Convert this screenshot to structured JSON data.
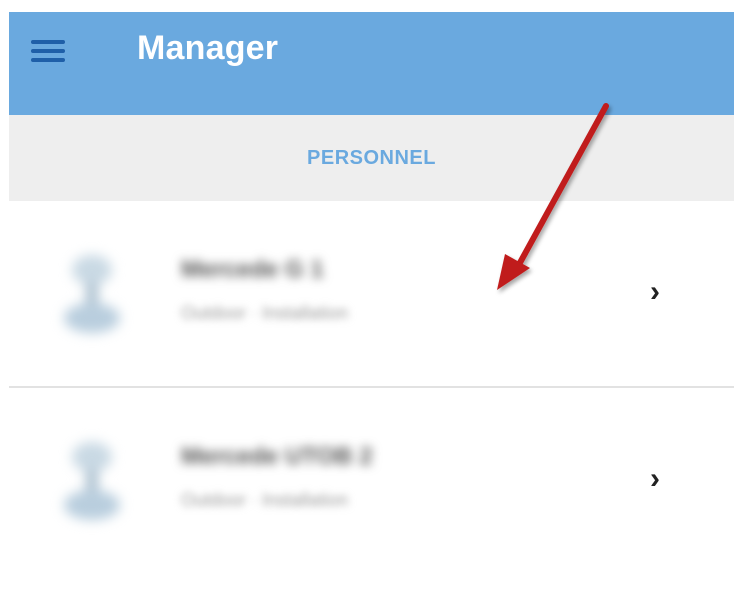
{
  "colors": {
    "appbar_bg": "#6aa9df",
    "menu_icon": "#1f5fa8",
    "tab_text": "#6aa9df",
    "annotation_arrow": "#c01a1a"
  },
  "appbar": {
    "title": "Manager",
    "menu_icon": "hamburger-menu-icon"
  },
  "tabs": [
    {
      "label": "PERSONNEL",
      "active": true
    }
  ],
  "list": {
    "items": [
      {
        "title": "Mercede G 1",
        "subtitle": "Outdoor · Installation",
        "avatar_icon": "device-avatar-icon",
        "chevron": "›"
      },
      {
        "title": "Mercede UTOB 2",
        "subtitle": "Outdoor · Installation",
        "avatar_icon": "device-avatar-icon",
        "chevron": "›"
      }
    ]
  }
}
